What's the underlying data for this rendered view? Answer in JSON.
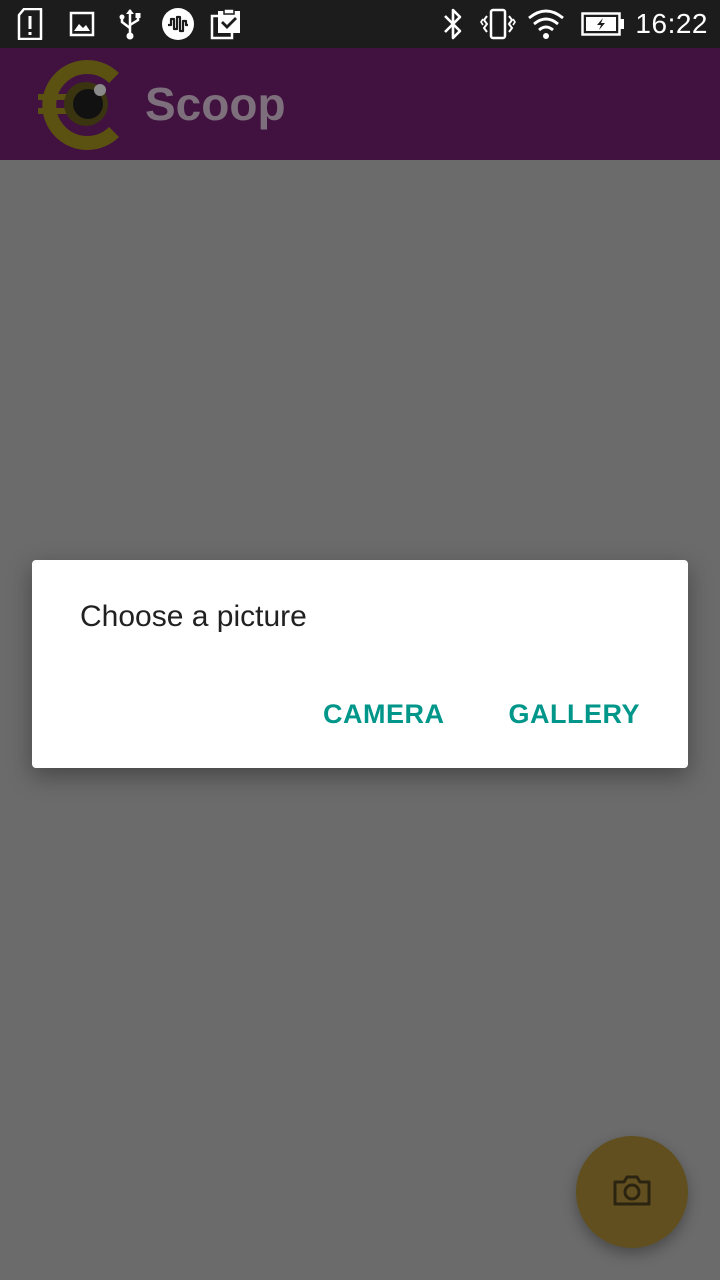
{
  "status_bar": {
    "time": "16:22",
    "left_icons": [
      "sim-alert-icon",
      "image-icon",
      "usb-icon",
      "musically-icon",
      "clipboard-check-icon"
    ],
    "right_icons": [
      "bluetooth-icon",
      "vibrate-icon",
      "wifi-icon",
      "battery-charging-icon"
    ]
  },
  "app_bar": {
    "title": "Scoop",
    "logo": "scoop-logo-icon"
  },
  "dialog": {
    "title": "Choose a picture",
    "actions": {
      "camera": "CAMERA",
      "gallery": "GALLERY"
    }
  },
  "fab": {
    "icon": "camera-icon"
  },
  "colors": {
    "accent": "#00968a",
    "app_bar": "#411240",
    "scrim": "#6b6b6b"
  }
}
